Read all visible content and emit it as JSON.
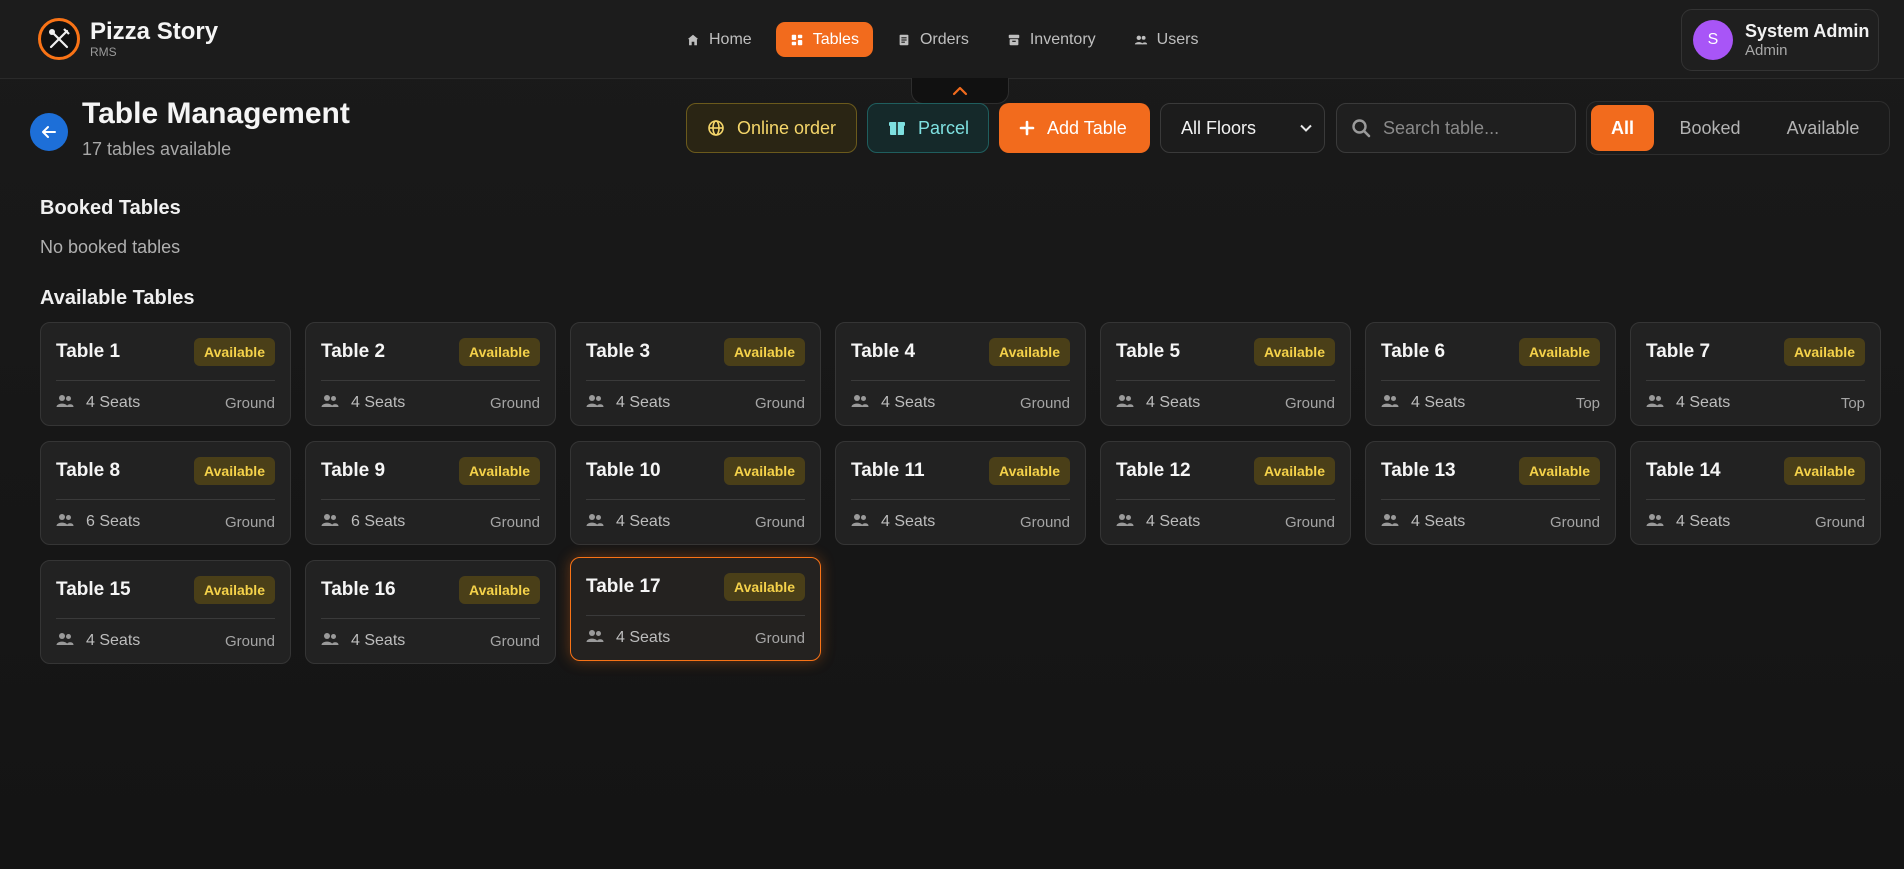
{
  "app": {
    "name": "Pizza Story",
    "sub": "RMS"
  },
  "nav": [
    {
      "label": "Home",
      "icon": "home-icon",
      "active": false
    },
    {
      "label": "Tables",
      "icon": "grid-icon",
      "active": true
    },
    {
      "label": "Orders",
      "icon": "receipt-icon",
      "active": false
    },
    {
      "label": "Inventory",
      "icon": "archive-icon",
      "active": false
    },
    {
      "label": "Users",
      "icon": "users-icon",
      "active": false
    }
  ],
  "user": {
    "initial": "S",
    "name": "System Admin",
    "role": "Admin"
  },
  "page": {
    "title": "Table Management",
    "subtitle": "17 tables available"
  },
  "toolbar": {
    "online_label": "Online order",
    "parcel_label": "Parcel",
    "add_label": "Add Table",
    "floor_selected": "All Floors",
    "search_placeholder": "Search table..."
  },
  "filters": {
    "all": "All",
    "booked": "Booked",
    "available": "Available"
  },
  "booked": {
    "title": "Booked Tables",
    "empty": "No booked tables"
  },
  "available": {
    "title": "Available Tables",
    "tables": [
      {
        "name": "Table 1",
        "status": "Available",
        "seats": "4 Seats",
        "floor": "Ground"
      },
      {
        "name": "Table 2",
        "status": "Available",
        "seats": "4 Seats",
        "floor": "Ground"
      },
      {
        "name": "Table 3",
        "status": "Available",
        "seats": "4 Seats",
        "floor": "Ground"
      },
      {
        "name": "Table 4",
        "status": "Available",
        "seats": "4 Seats",
        "floor": "Ground"
      },
      {
        "name": "Table 5",
        "status": "Available",
        "seats": "4 Seats",
        "floor": "Ground"
      },
      {
        "name": "Table 6",
        "status": "Available",
        "seats": "4 Seats",
        "floor": "Top"
      },
      {
        "name": "Table 7",
        "status": "Available",
        "seats": "4 Seats",
        "floor": "Top"
      },
      {
        "name": "Table 8",
        "status": "Available",
        "seats": "6 Seats",
        "floor": "Ground"
      },
      {
        "name": "Table 9",
        "status": "Available",
        "seats": "6 Seats",
        "floor": "Ground"
      },
      {
        "name": "Table 10",
        "status": "Available",
        "seats": "4 Seats",
        "floor": "Ground"
      },
      {
        "name": "Table 11",
        "status": "Available",
        "seats": "4 Seats",
        "floor": "Ground"
      },
      {
        "name": "Table 12",
        "status": "Available",
        "seats": "4 Seats",
        "floor": "Ground"
      },
      {
        "name": "Table 13",
        "status": "Available",
        "seats": "4 Seats",
        "floor": "Ground"
      },
      {
        "name": "Table 14",
        "status": "Available",
        "seats": "4 Seats",
        "floor": "Ground"
      },
      {
        "name": "Table 15",
        "status": "Available",
        "seats": "4 Seats",
        "floor": "Ground"
      },
      {
        "name": "Table 16",
        "status": "Available",
        "seats": "4 Seats",
        "floor": "Ground"
      },
      {
        "name": "Table 17",
        "status": "Available",
        "seats": "4 Seats",
        "floor": "Ground",
        "highlighted": true
      }
    ]
  },
  "colors": {
    "accent": "#f26b1d",
    "badge_bg": "#4a3f18",
    "badge_text": "#f5d24a",
    "avatar": "#a855f7",
    "back": "#1d6fd8"
  }
}
